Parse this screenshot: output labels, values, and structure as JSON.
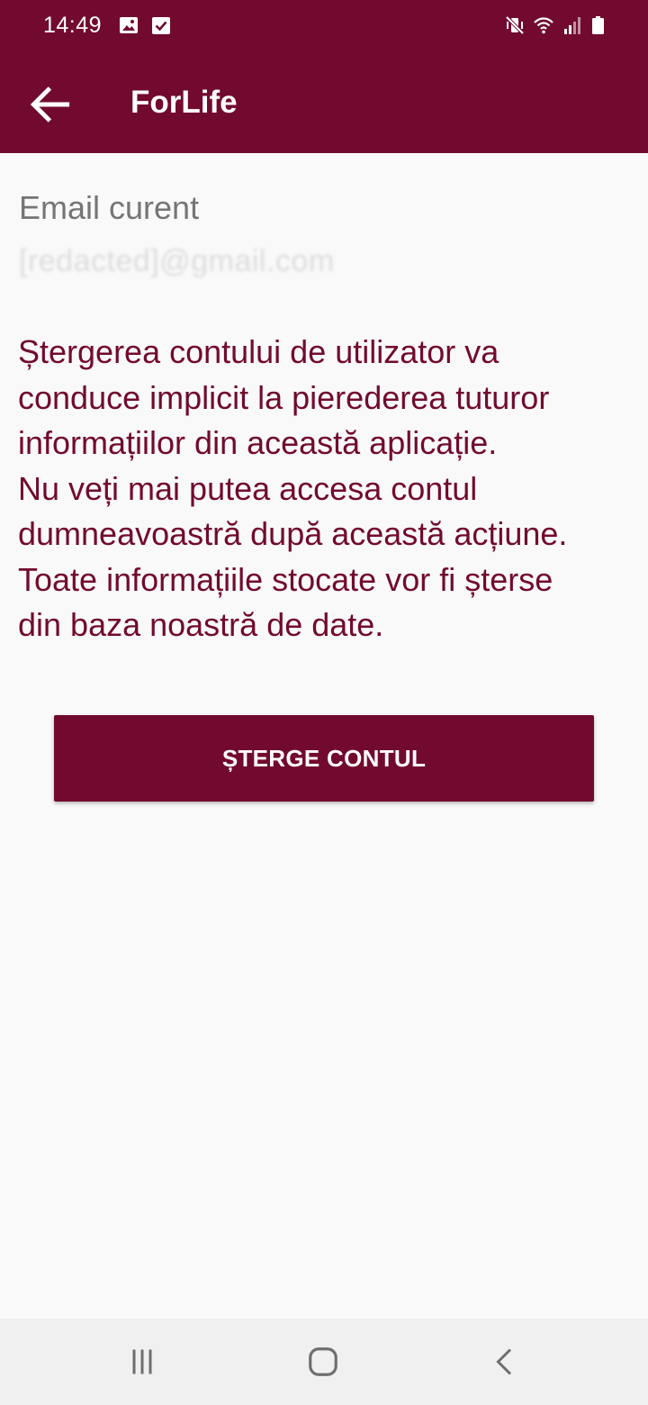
{
  "status_bar": {
    "time": "14:49",
    "left_icons": [
      "image-icon",
      "checkbox-icon"
    ],
    "right_icons": [
      "mute-vibrate-icon",
      "wifi-icon",
      "signal-icon",
      "battery-icon"
    ]
  },
  "app_bar": {
    "title": "ForLife",
    "back_icon": "arrow-back-icon"
  },
  "account": {
    "email_label": "Email curent",
    "email_value": "[redacted]@gmail.com"
  },
  "warning_text": "Ștergerea contului de utilizator va\nconduce implicit la pierederea tuturor\ninformațiilor din această aplicație.\nNu veți mai putea accesa contul\ndumneavoastră după această acțiune.\nToate informațiile stocate vor fi șterse\ndin baza noastră de date.",
  "actions": {
    "delete_label": "ȘTERGE CONTUL"
  },
  "nav_bar": {
    "buttons": [
      "recent-apps-icon",
      "home-icon",
      "back-icon"
    ]
  },
  "colors": {
    "brand": "#720a2f",
    "background": "#f9f9f9",
    "label_gray": "#757575",
    "nav_bar": "#f0f0f0"
  }
}
